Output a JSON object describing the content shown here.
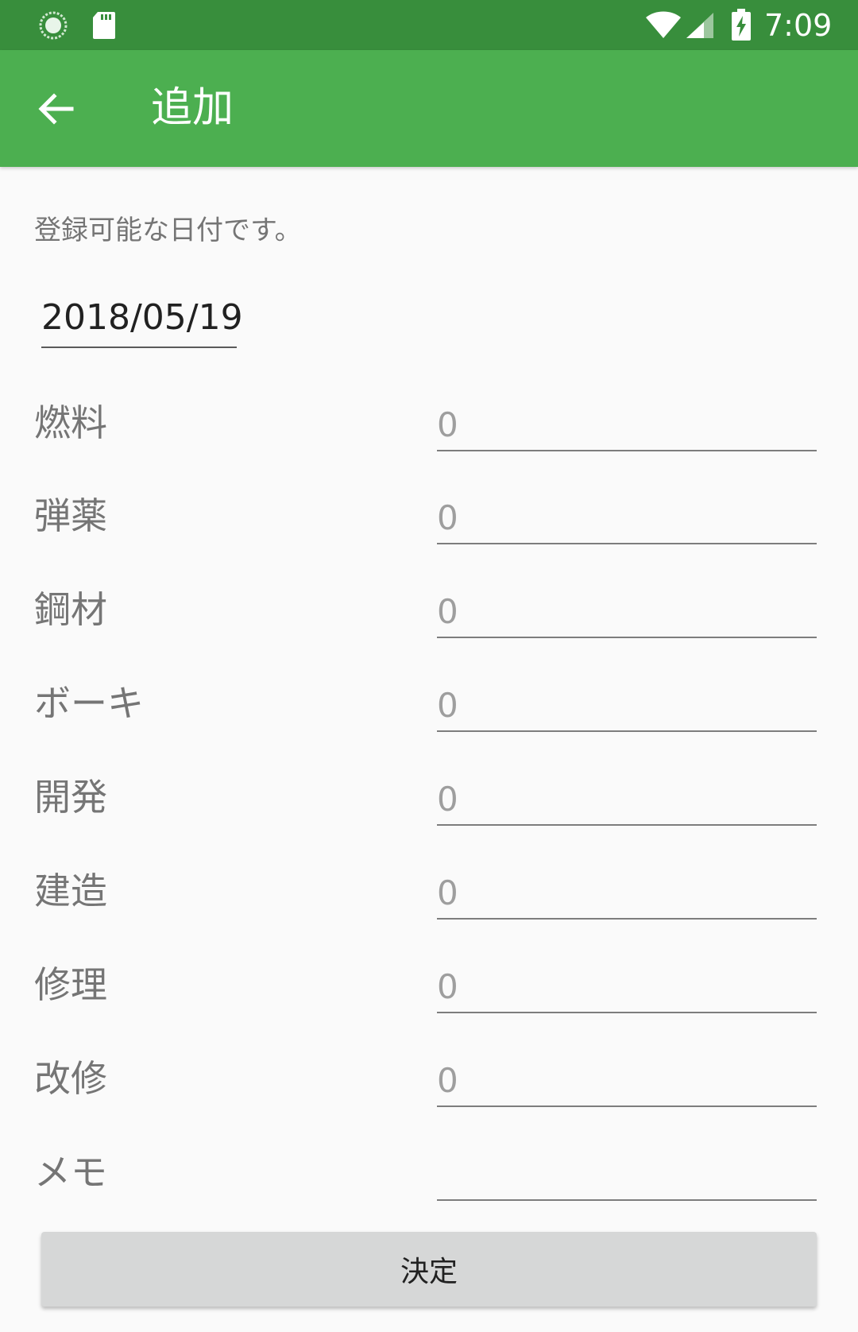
{
  "status_bar": {
    "time": "7:09",
    "icons": [
      "sync-icon",
      "sd-card-icon",
      "wifi-icon",
      "cell-signal-icon",
      "battery-charging-icon"
    ]
  },
  "app_bar": {
    "title": "追加",
    "back_icon": "arrow-back-icon"
  },
  "form": {
    "hint": "登録可能な日付です。",
    "date": "2018/05/19",
    "fields": [
      {
        "label": "燃料",
        "placeholder": "0"
      },
      {
        "label": "弾薬",
        "placeholder": "0"
      },
      {
        "label": "鋼材",
        "placeholder": "0"
      },
      {
        "label": "ボーキ",
        "placeholder": "0"
      },
      {
        "label": "開発",
        "placeholder": "0"
      },
      {
        "label": "建造",
        "placeholder": "0"
      },
      {
        "label": "修理",
        "placeholder": "0"
      },
      {
        "label": "改修",
        "placeholder": "0"
      },
      {
        "label": "メモ",
        "placeholder": ""
      }
    ],
    "submit_label": "決定"
  },
  "colors": {
    "status_bar": "#388e3c",
    "app_bar": "#4caf50",
    "background": "#fafafa",
    "button": "#d6d7d7"
  }
}
